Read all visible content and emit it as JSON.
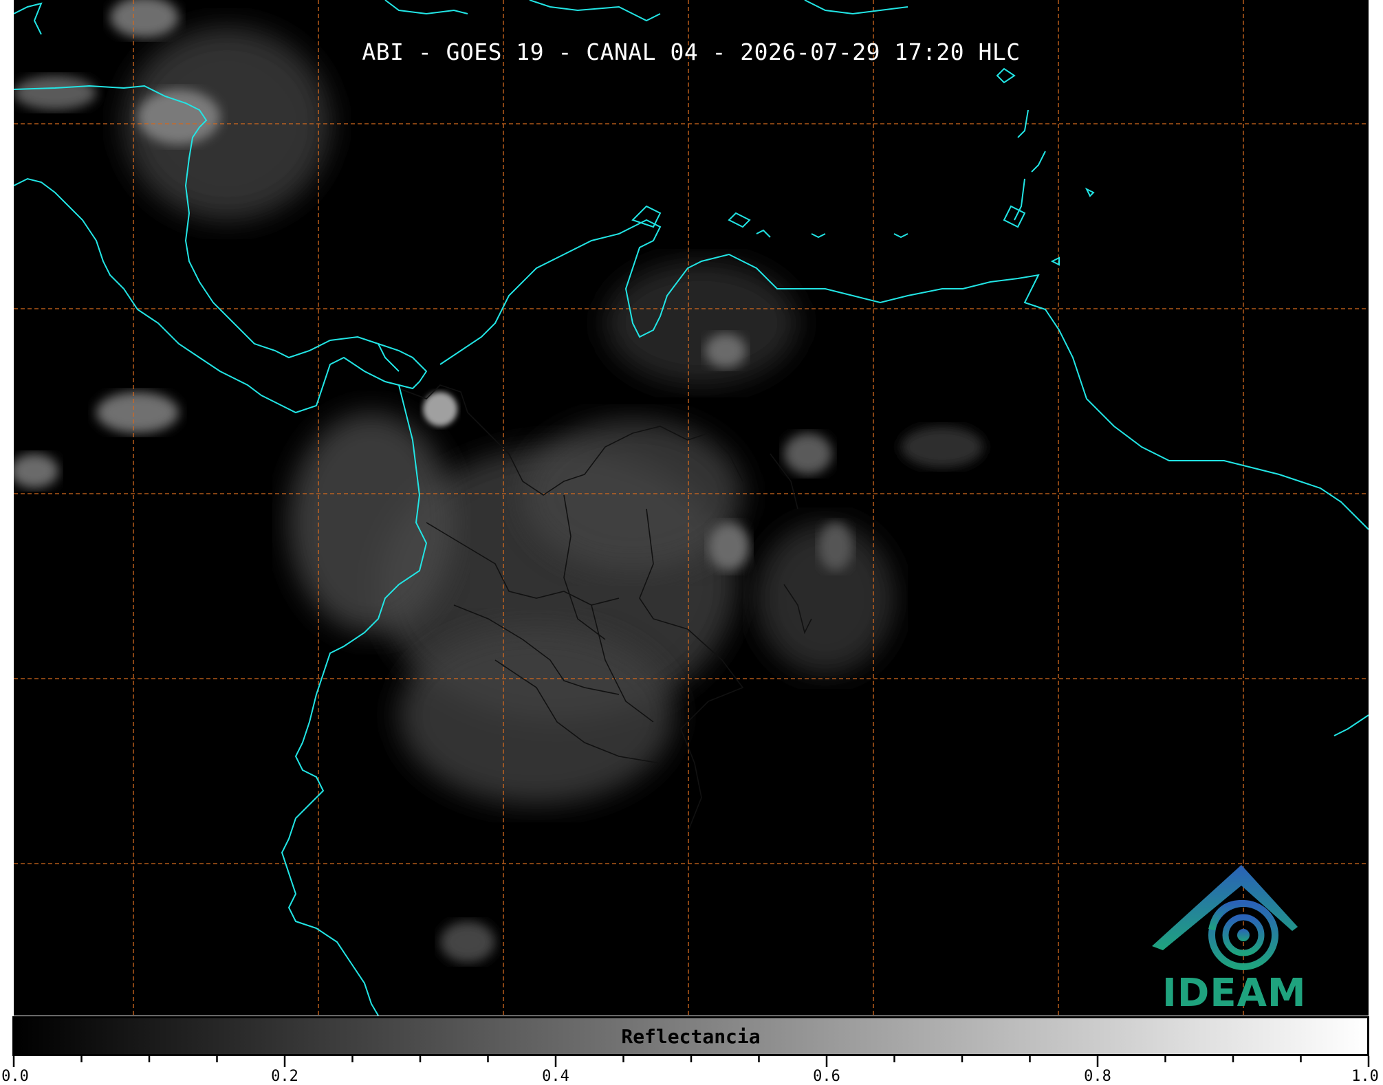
{
  "title": "ABI - GOES 19 - CANAL 04 - 2026-07-29 17:20 HLC",
  "map": {
    "coastline_color": "#22e5e5",
    "border_color": "#1a1a1a",
    "grid_color": "#d2691e",
    "background_color": "#000000"
  },
  "logo": {
    "text": "IDEAM",
    "color_top": "#2a62b8",
    "color_bottom": "#1fa37e",
    "icon": "ideam-mountain-swirl-icon"
  },
  "colorbar": {
    "label": "Reflectancia",
    "range": [
      0.0,
      1.0
    ],
    "colors": [
      "#000000",
      "#ffffff"
    ],
    "major_ticks": [
      "0.0",
      "0.2",
      "0.4",
      "0.6",
      "0.8",
      "1.0"
    ],
    "minor_tick_step": 0.05
  }
}
